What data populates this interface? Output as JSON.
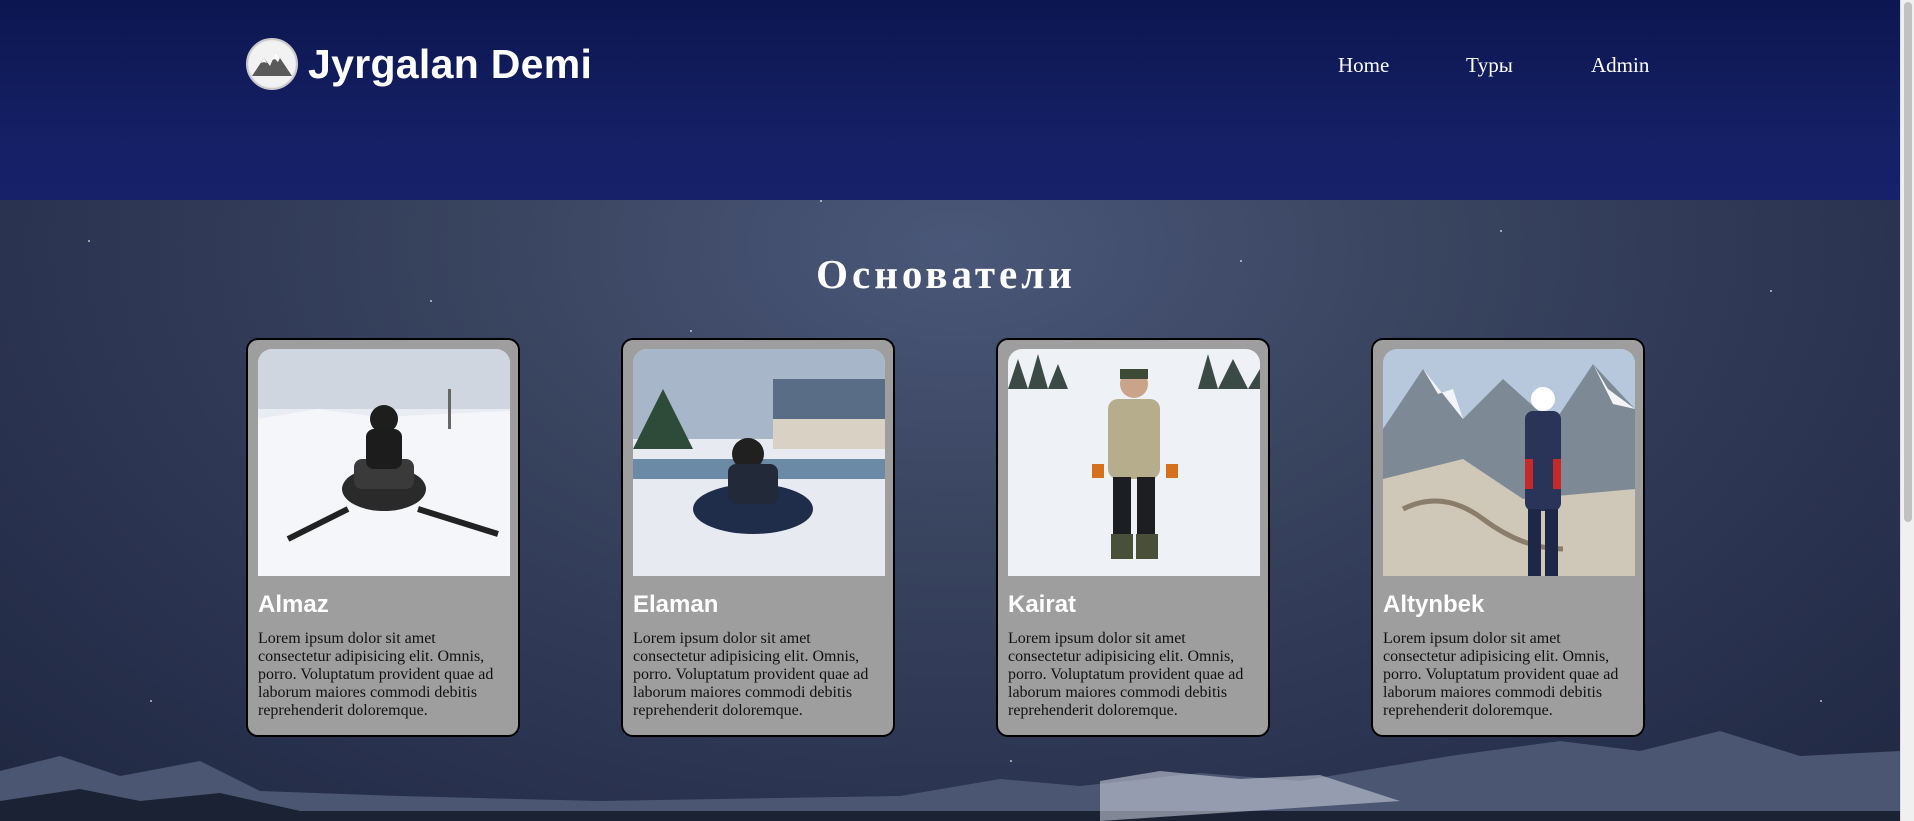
{
  "brand": {
    "name": "Jyrgalan Demi",
    "logo_icon": "mountain-logo-icon"
  },
  "nav": {
    "items": [
      "Home",
      "Туры",
      "Admin"
    ]
  },
  "section": {
    "title": "Основатели"
  },
  "founders": [
    {
      "name": "Almaz",
      "text": "Lorem ipsum dolor sit amet consectetur adipisicing elit. Omnis, porro. Voluptatum provident quae ad laborum maiores commodi debitis reprehenderit doloremque."
    },
    {
      "name": "Elaman",
      "text": "Lorem ipsum dolor sit amet consectetur adipisicing elit. Omnis, porro. Voluptatum provident quae ad laborum maiores commodi debitis reprehenderit doloremque."
    },
    {
      "name": "Kairat",
      "text": "Lorem ipsum dolor sit amet consectetur adipisicing elit. Omnis, porro. Voluptatum provident quae ad laborum maiores commodi debitis reprehenderit doloremque."
    },
    {
      "name": "Altynbek",
      "text": "Lorem ipsum dolor sit amet consectetur adipisicing elit. Omnis, porro. Voluptatum provident quae ad laborum maiores commodi debitis reprehenderit doloremque."
    }
  ],
  "colors": {
    "header": "#0c1650",
    "card": "#9e9e9e",
    "text": "#ffffff"
  }
}
